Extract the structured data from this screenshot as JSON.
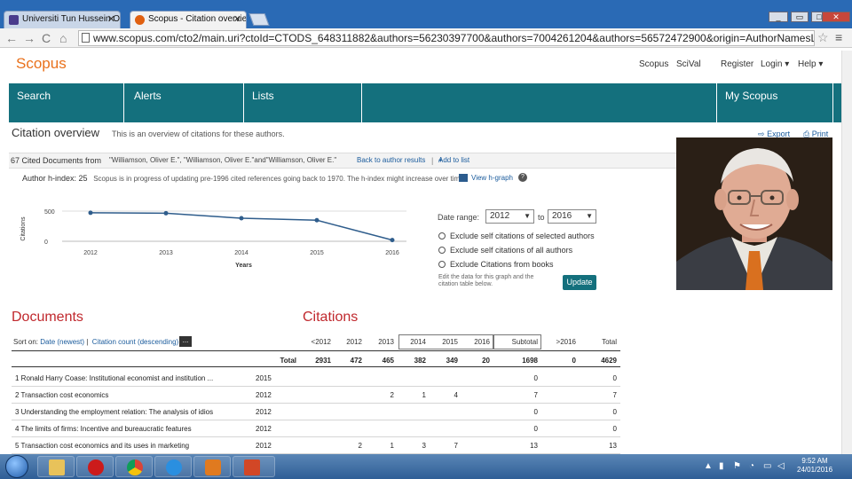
{
  "browser": {
    "tabs": [
      {
        "title": "Universiti Tun Hussein On"
      },
      {
        "title": "Scopus - Citation overview"
      }
    ],
    "url": "www.scopus.com/cto2/main.uri?ctoId=CTODS_648311882&authors=56230397700&authors=7004261204&authors=56572472900&origin=AuthorNamesList"
  },
  "header": {
    "logo": "Scopus",
    "links": [
      "Scopus",
      "SciVal",
      "Register",
      "Login",
      "Help"
    ]
  },
  "navbar": {
    "items": [
      "Search",
      "Alerts",
      "Lists",
      "My Scopus"
    ]
  },
  "overview": {
    "title": "Citation overview",
    "subtitle": "This is an overview of citations for these authors.",
    "export": "Export",
    "print": "Print",
    "cited_docs": "67 Cited Documents from",
    "authors": "\"Williamson, Oliver E.\", \"Williamson, Oliver E.\"and\"Williamson, Oliver E.\"",
    "back_link": "Back to author results",
    "add_list": "Add to list",
    "hindex_label": "Author h-index: 25",
    "hindex_note": "Scopus is in progress of updating pre-1996 cited references going back to 1970. The h-index might increase over time.",
    "view_graph": "View h-graph"
  },
  "chart_data": {
    "type": "line",
    "x": [
      "2012",
      "2013",
      "2014",
      "2015",
      "2016"
    ],
    "values": [
      472,
      465,
      382,
      349,
      20
    ],
    "ylabel": "Citations",
    "xlabel": "Years",
    "yticks": [
      "500",
      "0"
    ],
    "ylim": [
      0,
      500
    ]
  },
  "controls": {
    "date_range_label": "Date range:",
    "from_year": "2012",
    "to_label": "to",
    "to_year": "2016",
    "options": [
      "Exclude self citations of selected authors",
      "Exclude self citations of all authors",
      "Exclude Citations from books"
    ],
    "edit_text": "Edit the data for this graph and the citation table below.",
    "update_button": "Update"
  },
  "documents": {
    "heading": "Documents",
    "citations_heading": "Citations",
    "sort_label": "Sort on:",
    "sort_date": "Date (newest)",
    "sort_count": "Citation count (descending)",
    "more": "...",
    "columns": [
      "<2012",
      "2012",
      "2013",
      "2014",
      "2015",
      "2016",
      "Subtotal",
      ">2016",
      "Total"
    ],
    "total_label": "Total",
    "totals": [
      "2931",
      "472",
      "465",
      "382",
      "349",
      "20",
      "1698",
      "0",
      "4629"
    ],
    "rows": [
      {
        "title": "1  Ronald Harry Coase: Institutional economist and institution ...",
        "year": "2015",
        "values": [
          "",
          "",
          "",
          "",
          "",
          "",
          "0",
          "",
          "0"
        ]
      },
      {
        "title": "2  Transaction cost economics",
        "year": "2012",
        "values": [
          "",
          "",
          "2",
          "1",
          "4",
          "",
          "7",
          "",
          "7"
        ]
      },
      {
        "title": "3  Understanding the employment relation: The analysis of idios",
        "year": "2012",
        "values": [
          "",
          "",
          "",
          "",
          "",
          "",
          "0",
          "",
          "0"
        ]
      },
      {
        "title": "4  The limits of firms: Incentive and bureaucratic features",
        "year": "2012",
        "values": [
          "",
          "",
          "",
          "",
          "",
          "",
          "0",
          "",
          "0"
        ]
      },
      {
        "title": "5  Transaction cost economics and its uses in marketing",
        "year": "2012",
        "values": [
          "",
          "2",
          "1",
          "3",
          "7",
          "",
          "13",
          "",
          "13"
        ]
      }
    ]
  },
  "taskbar": {
    "time": "9:52 AM",
    "date": "24/01/2016"
  }
}
